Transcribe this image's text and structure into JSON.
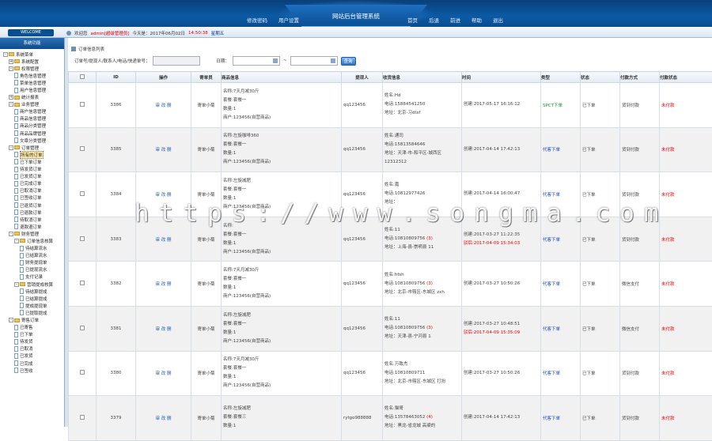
{
  "header": {
    "title": "网站后台管理系统",
    "nav_left": [
      "修改密码",
      "用户设置"
    ],
    "nav_right": [
      "首页",
      "后退",
      "前进",
      "帮助",
      "退出"
    ]
  },
  "topbar": {
    "welcome": "WELCOME",
    "greeting": "欢迎您",
    "user": "admin[超级管理员]",
    "today_label": "今天是：2017年06月02日",
    "time": "14:50:38",
    "weekday": "星期五"
  },
  "sidebar": {
    "title": "系统功能",
    "items": [
      {
        "label": "系统菜单",
        "level": 0,
        "type": "folder",
        "toggle": "-"
      },
      {
        "label": "系统配置",
        "level": 1,
        "type": "folder",
        "toggle": "+"
      },
      {
        "label": "权限管理",
        "level": 1,
        "type": "folder",
        "toggle": "-"
      },
      {
        "label": "角色信息管理",
        "level": 2,
        "type": "doc"
      },
      {
        "label": "菜单信息管理",
        "level": 2,
        "type": "doc"
      },
      {
        "label": "用户信息管理",
        "level": 2,
        "type": "doc"
      },
      {
        "label": "统计报表",
        "level": 1,
        "type": "folder",
        "toggle": "+"
      },
      {
        "label": "业务管理",
        "level": 1,
        "type": "folder",
        "toggle": "-"
      },
      {
        "label": "商户信息管理",
        "level": 2,
        "type": "doc"
      },
      {
        "label": "商品信息管理",
        "level": 2,
        "type": "doc"
      },
      {
        "label": "商品分类管理",
        "level": 2,
        "type": "doc"
      },
      {
        "label": "商品品牌管理",
        "level": 2,
        "type": "doc"
      },
      {
        "label": "文章分类管理",
        "level": 2,
        "type": "doc"
      },
      {
        "label": "订单管理",
        "level": 1,
        "type": "folder",
        "toggle": "-"
      },
      {
        "label": "所有的订单",
        "level": 2,
        "type": "doc",
        "selected": true
      },
      {
        "label": "已下单订单",
        "level": 2,
        "type": "doc"
      },
      {
        "label": "待发货订单",
        "level": 2,
        "type": "doc"
      },
      {
        "label": "已发货订单",
        "level": 2,
        "type": "doc"
      },
      {
        "label": "已完成订单",
        "level": 2,
        "type": "doc"
      },
      {
        "label": "已取消订单",
        "level": 2,
        "type": "doc"
      },
      {
        "label": "已签收订单",
        "level": 2,
        "type": "doc"
      },
      {
        "label": "已退货订单",
        "level": 2,
        "type": "doc"
      },
      {
        "label": "已退款订单",
        "level": 2,
        "type": "doc"
      },
      {
        "label": "待取消订单",
        "level": 2,
        "type": "doc"
      },
      {
        "label": "退款退订单",
        "level": 2,
        "type": "doc"
      },
      {
        "label": "财务管理",
        "level": 1,
        "type": "folder",
        "toggle": "-"
      },
      {
        "label": "订单信息核算",
        "level": 2,
        "type": "folder",
        "toggle": "-"
      },
      {
        "label": "待结算流水",
        "level": 3,
        "type": "doc"
      },
      {
        "label": "已结算流水",
        "level": 3,
        "type": "doc"
      },
      {
        "label": "财务提现单",
        "level": 3,
        "type": "doc"
      },
      {
        "label": "已提现流水",
        "level": 3,
        "type": "doc"
      },
      {
        "label": "支付记录",
        "level": 3,
        "type": "doc"
      },
      {
        "label": "营销提成核算",
        "level": 2,
        "type": "folder",
        "toggle": "-"
      },
      {
        "label": "待结算提成",
        "level": 3,
        "type": "doc"
      },
      {
        "label": "已结算提成",
        "level": 3,
        "type": "doc"
      },
      {
        "label": "提成提现单",
        "level": 3,
        "type": "doc"
      },
      {
        "label": "已提取提成",
        "level": 3,
        "type": "doc"
      },
      {
        "label": "寄售订单",
        "level": 1,
        "type": "folder",
        "toggle": "-"
      },
      {
        "label": "已寄售",
        "level": 2,
        "type": "doc"
      },
      {
        "label": "已下单",
        "level": 2,
        "type": "doc"
      },
      {
        "label": "待发货",
        "level": 2,
        "type": "doc"
      },
      {
        "label": "已取消",
        "level": 2,
        "type": "doc"
      },
      {
        "label": "已发货",
        "level": 2,
        "type": "doc"
      },
      {
        "label": "已完成",
        "level": 2,
        "type": "doc"
      },
      {
        "label": "已签收",
        "level": 2,
        "type": "doc"
      }
    ]
  },
  "page": {
    "list_title": "订单信息列表",
    "search_label": "订单号/提现人/联系人/电话/快递单号：",
    "date_label": "日期：",
    "date_sep": "~",
    "search_button": "查询"
  },
  "table": {
    "headers": [
      "ID",
      "操作",
      "寄单员",
      "商品信息",
      "提现人",
      "收货信息",
      "时间",
      "类型",
      "状态",
      "付款方式",
      "付款状态"
    ],
    "rows": [
      {
        "id": "3386",
        "op": "审 改 删",
        "agent": "寄单小菊",
        "prod": [
          "名称:7天月减30斤",
          "套餐:套餐一",
          "数量:1",
          "商户:123456(自营商品)"
        ],
        "buyer": "qq123456",
        "recv": [
          "姓名:Hd",
          "电话:15884541250",
          "地址：北京-习dtsf"
        ],
        "recv_red": "",
        "time": [
          "创建:2017-05-17 16:16:12"
        ],
        "time_red": "",
        "type": "SPCT下单",
        "type_color": "#0a9a2a",
        "status": "已下单",
        "pay": "货到付款",
        "paystate": "未付款"
      },
      {
        "id": "3385",
        "op": "审 改 删",
        "agent": "寄单小菊",
        "prod": [
          "名称:左旋咖啡360",
          "套餐:套餐一",
          "数量:1",
          "商户:123456(自营商品)"
        ],
        "buyer": "qq123456",
        "recv": [
          "姓名:通司",
          "电话:15813584646",
          "地址：天津-市-和平区-城西区 12312312"
        ],
        "recv_red": "",
        "time": [
          "创建:2017-04-14 17:42:13"
        ],
        "time_red": "",
        "type": "代客下单",
        "type_color": "#1447c9",
        "status": "已下单",
        "pay": "货到付款",
        "paystate": "未付款"
      },
      {
        "id": "3384",
        "op": "审 改 删",
        "agent": "寄单小菊",
        "prod": [
          "名称:左旋减肥",
          "套餐:套餐一",
          "数量:1",
          "商户:123456(自营商品)"
        ],
        "buyer": "qq123456",
        "recv": [
          "姓名:嘉",
          "电话:10812977426",
          "地址："
        ],
        "recv_red": "",
        "time": [
          "创建:2017-04-14 16:00:47"
        ],
        "time_red": "",
        "type": "代客下单",
        "type_color": "#1447c9",
        "status": "已下单",
        "pay": "货到付款",
        "paystate": "未付款"
      },
      {
        "id": "3383",
        "op": "审 改 删",
        "agent": "寄单小菊",
        "prod": [
          "名称:",
          "套餐:套餐一",
          "数量:1",
          "商户:123456(自营商品)"
        ],
        "buyer": "qq123456",
        "recv": [
          "姓名:11",
          "电话:10810809756",
          "地址：上海-县-崇明县 11"
        ],
        "recv_red": "(3)",
        "time": [
          "创建:2017-03-27 11:22:35"
        ],
        "time_red": "驳后:2017-04-09 15:34:03",
        "type": "代客下单",
        "type_color": "#1447c9",
        "status": "已下单",
        "pay": "货到付款",
        "paystate": "未付款"
      },
      {
        "id": "3382",
        "op": "审 改 删",
        "agent": "寄单小菊",
        "prod": [
          "名称:7天月减30斤",
          "套餐:套餐一",
          "数量:1",
          "商户:123456(自营商品)"
        ],
        "buyer": "qq123456",
        "recv": [
          "姓名:hfsh",
          "电话:10810809756",
          "地址：北京-市辖区-东城区 zxh"
        ],
        "recv_red": "(3)",
        "time": [
          "创建:2017-03-27 10:50:26"
        ],
        "time_red": "",
        "type": "代客下单",
        "type_color": "#1447c9",
        "status": "已下单",
        "pay": "微信支付",
        "paystate": "未付款"
      },
      {
        "id": "3381",
        "op": "审 改 删",
        "agent": "寄单小菊",
        "prod": [
          "名称:左旋减肥",
          "套餐:套餐一",
          "数量:1",
          "商户:123456(自营商品)"
        ],
        "buyer": "qq123456",
        "recv": [
          "姓名:11",
          "电话:10810809756",
          "地址：天津-县-宁河县 1"
        ],
        "recv_red": "(3)",
        "time": [
          "创建:2017-03-27 10:48:51"
        ],
        "time_red": "驳后:2017-04-09 15:35:09",
        "type": "代客下单",
        "type_color": "#1447c9",
        "status": "已下单",
        "pay": "微信支付",
        "paystate": "未付款"
      },
      {
        "id": "3380",
        "op": "审 改 删",
        "agent": "寄单小菊",
        "prod": [
          "名称:7天月减30斤",
          "套餐:套餐一",
          "数量:1",
          "商户:123456(自营商品)"
        ],
        "buyer": "qq123456",
        "recv": [
          "姓名:万致杰",
          "电话:10810809711",
          "地址：北京-市辖区-东城区 打扮"
        ],
        "recv_red": "",
        "time": [
          "创建:2017-03-27 10:50:26"
        ],
        "time_red": "",
        "type": "代客下单",
        "type_color": "#1447c9",
        "status": "已下单",
        "pay": "货到付款",
        "paystate": "未付款"
      },
      {
        "id": "3379",
        "op": "审 改 删",
        "agent": "寄单小菊",
        "prod": [
          "名称:左旋减肥",
          "套餐:套餐三",
          "数量:1",
          ""
        ],
        "buyer": "rytgo988888",
        "recv": [
          "姓名:猫哥",
          "电话:13578463052",
          "地址：黑龙-省龙城 高粱的"
        ],
        "recv_red": "(4)",
        "time": [
          "创建:2017-04-14 17:42:13"
        ],
        "time_red": "",
        "type": "代客下单",
        "type_color": "#1447c9",
        "status": "已下单",
        "pay": "货到付款",
        "paystate": "未付款"
      }
    ]
  },
  "watermark": "https://www.songma.com"
}
